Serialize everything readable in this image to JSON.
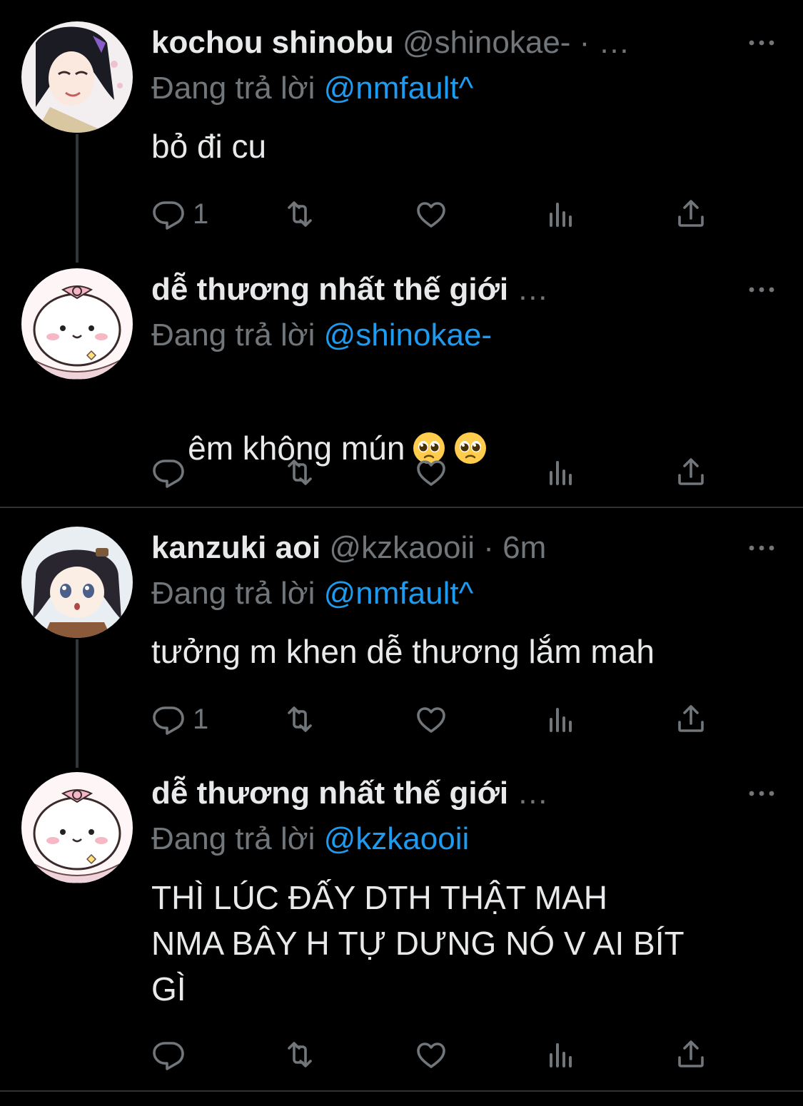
{
  "threads": [
    {
      "tweets": [
        {
          "name": "kochou shinobu",
          "handle": "@shinokae- · …",
          "reply_label": "Đang trả lời",
          "reply_to": "@nmfault^",
          "text": "bỏ đi cu",
          "reply_count": "1"
        },
        {
          "name": "dễ thương nhất thế giới",
          "handle": "…",
          "reply_label": "Đang trả lời",
          "reply_to": "@shinokae-",
          "text": "êm không mún",
          "emoji": [
            "pleading-face",
            "pleading-face"
          ],
          "reply_count": ""
        }
      ]
    },
    {
      "tweets": [
        {
          "name": "kanzuki aoi",
          "handle": "@kzkaooii · 6m",
          "reply_label": "Đang trả lời",
          "reply_to": "@nmfault^",
          "text": "tưởng m khen dễ thương lắm mah",
          "reply_count": "1"
        },
        {
          "name": "dễ thương nhất thế giới",
          "handle": "…",
          "reply_label": "Đang trả lời",
          "reply_to": "@kzkaooii",
          "text": "THÌ LÚC ĐẤY DTH THẬT MAH\nNMA BÂY H TỰ DƯNG NÓ V AI BÍT\nGÌ",
          "reply_count": ""
        }
      ]
    }
  ],
  "colors": {
    "background": "#000000",
    "text": "#e7e9ea",
    "muted": "#71767b",
    "mention": "#1d9bf0",
    "divider": "#2f3336"
  },
  "icons": [
    "reply-icon",
    "retweet-icon",
    "like-icon",
    "views-icon",
    "share-icon",
    "more-icon"
  ]
}
